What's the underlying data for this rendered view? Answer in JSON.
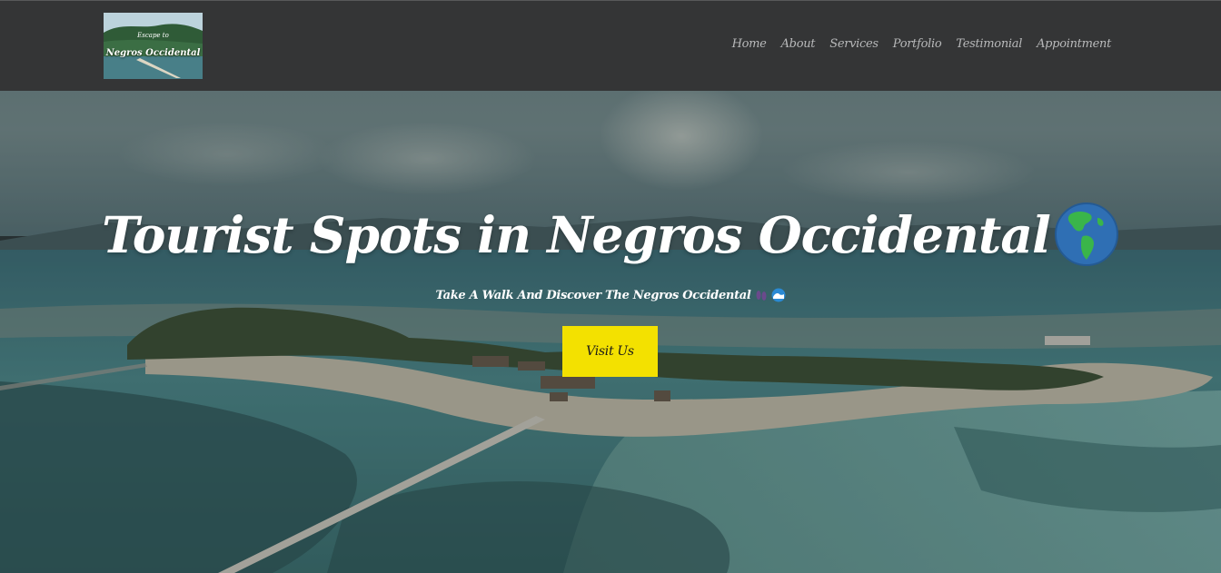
{
  "logo": {
    "caption_small": "Escape to",
    "caption_main": "Negros Occidental"
  },
  "nav": {
    "items": [
      {
        "label": "Home"
      },
      {
        "label": "About"
      },
      {
        "label": "Services"
      },
      {
        "label": "Portfolio"
      },
      {
        "label": "Testimonial"
      },
      {
        "label": "Appointment"
      }
    ]
  },
  "hero": {
    "title": "Tourist Spots in Negros Occidental",
    "title_icon": "globe-americas-icon",
    "subtitle": "Take A Walk And Discover The Negros Occidental",
    "subtitle_icons": [
      "footprints-icon",
      "wave-icon"
    ],
    "button_label": "Visit Us"
  },
  "colors": {
    "navbar_bg": "#343536",
    "nav_text": "#b8b9ba",
    "button_bg": "#f3e100",
    "hero_text": "#ffffff"
  }
}
